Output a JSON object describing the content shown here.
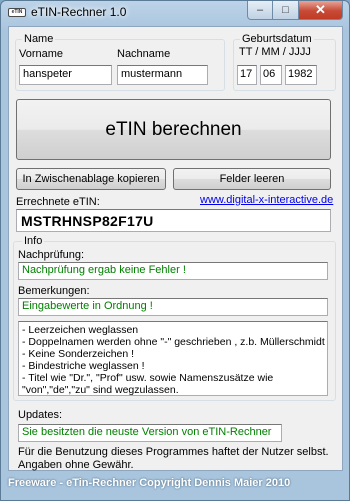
{
  "window": {
    "title": "eTIN-Rechner 1.0",
    "icon_text": "eTIN"
  },
  "name_group": {
    "legend": "Name",
    "vorname_label": "Vorname",
    "nachname_label": "Nachname",
    "vorname_value": "hanspeter",
    "nachname_value": "mustermann"
  },
  "birth_group": {
    "legend": "Geburtsdatum",
    "format_label": "TT / MM / JJJJ",
    "day": "17",
    "month": "06",
    "year": "1982"
  },
  "calculate_button": "eTIN berechnen",
  "copy_button": "In Zwischenablage kopieren",
  "clear_button": "Felder leeren",
  "result": {
    "label": "Errechnete eTIN:",
    "link": "www.digital-x-interactive.de",
    "value": "MSTRHNSP82F17U"
  },
  "info": {
    "legend": "Info",
    "check_label": "Nachprüfung:",
    "check_value": "Nachprüfung ergab keine Fehler !",
    "remarks_label": "Bemerkungen:",
    "remarks_value": "Eingabewerte in Ordnung !",
    "notes": [
      "- Leerzeichen weglassen",
      "- Doppelnamen werden ohne \"-\" geschrieben , z.b. Müllerschmidt",
      "- Keine Sonderzeichen !",
      "- Bindestriche weglassen !",
      "- Titel wie \"Dr.\", \"Prof\" usw. sowie Namenszusätze wie",
      "\"von\",\"de\",\"zu\" sind wegzulassen."
    ]
  },
  "updates": {
    "label": "Updates:",
    "value": "Sie besitzten die neuste Version von eTIN-Rechner"
  },
  "disclaimer": [
    "Für die Benutzung dieses Programmes haftet der Nutzer selbst.",
    "Angaben ohne Gewähr."
  ],
  "statusbar": "Freeware - eTin-Rechner Copyright Dennis Maier 2010",
  "colors": {
    "ok_text": "#008000",
    "link": "#0000ee",
    "close_button": "#c74a36"
  }
}
